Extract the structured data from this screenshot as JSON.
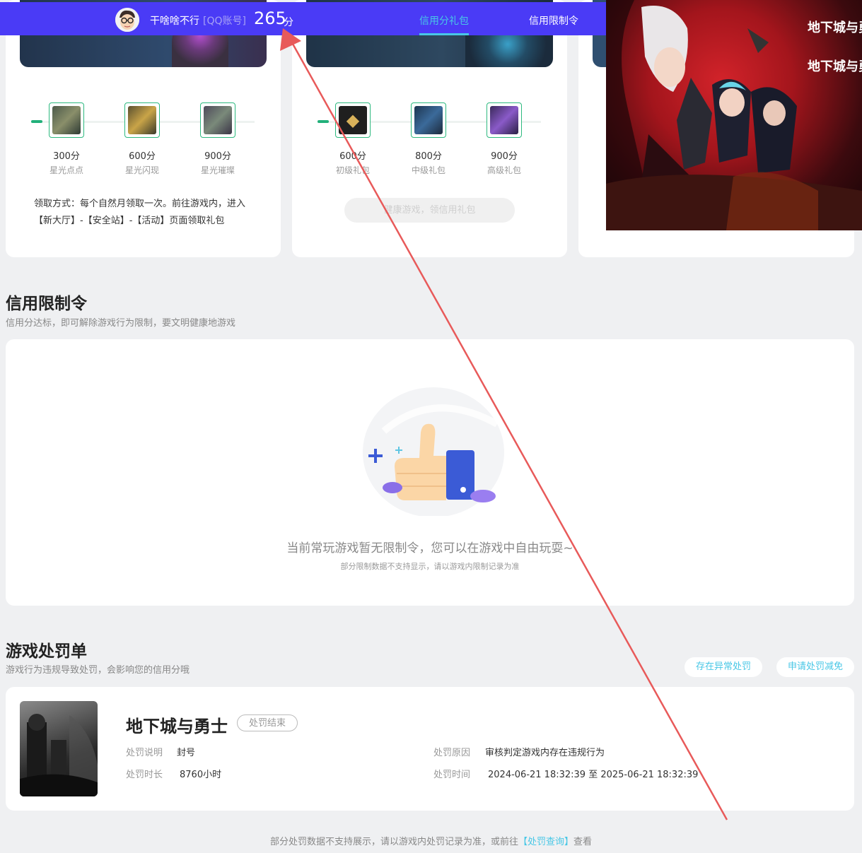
{
  "header": {
    "username": "干啥啥不行",
    "account_type": "[QQ账号]",
    "score": "265",
    "score_unit": "分",
    "nav": [
      "信用分礼包",
      "信用限制令"
    ]
  },
  "rewards": {
    "card1": {
      "items": [
        {
          "points": "300分",
          "name": "星光点点"
        },
        {
          "points": "600分",
          "name": "星光闪现"
        },
        {
          "points": "900分",
          "name": "星光璀璨"
        }
      ],
      "claim_text": "领取方式：每个自然月领取一次。前往游戏内，进入【新大厅】-【安全站】-【活动】页面领取礼包"
    },
    "card2": {
      "items": [
        {
          "points": "600分",
          "name": "初级礼包"
        },
        {
          "points": "800分",
          "name": "中级礼包"
        },
        {
          "points": "900分",
          "name": "高级礼包"
        }
      ],
      "button_label": "健康游戏，领信用礼包"
    }
  },
  "overlay_art": {
    "logo_text_1": "地下城与勇士",
    "logo_text_2": "地下城与勇士"
  },
  "restriction": {
    "title": "信用限制令",
    "subtitle": "信用分达标，即可解除游戏行为限制，要文明健康地游戏",
    "empty_main": "当前常玩游戏暂无限制令，您可以在游戏中自由玩耍~",
    "empty_sub": "部分限制数据不支持显示，请以游戏内限制记录为准"
  },
  "penalty": {
    "title": "游戏处罚单",
    "subtitle": "游戏行为违规导致处罚，会影响您的信用分哦",
    "abnormal_button": "存在异常处罚",
    "reduce_button": "申请处罚减免",
    "record": {
      "game_name": "地下城与勇士",
      "status": "处罚结束",
      "desc_label": "处罚说明",
      "desc_value": "封号",
      "reason_label": "处罚原因",
      "reason_value": "审核判定游戏内存在违规行为",
      "duration_label": "处罚时长",
      "duration_value": "8760小时",
      "time_label": "处罚时间",
      "time_value": "2024-06-21 18:32:39 至 2025-06-21 18:32:39"
    }
  },
  "footer": {
    "note_prefix": "部分处罚数据不支持展示，请以游戏内处罚记录为准，或前往",
    "link": "【处罚查询】",
    "note_suffix": "查看"
  },
  "colors": {
    "header_bg": "#4a3bf6",
    "accent": "#48c7e6",
    "green": "#2db97f",
    "arrow": "#e85a5a"
  }
}
